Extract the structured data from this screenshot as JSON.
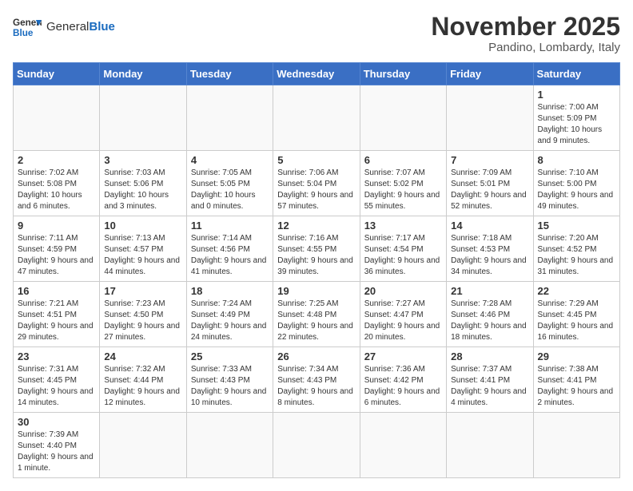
{
  "header": {
    "logo_general": "General",
    "logo_blue": "Blue",
    "month_title": "November 2025",
    "location": "Pandino, Lombardy, Italy"
  },
  "days_of_week": [
    "Sunday",
    "Monday",
    "Tuesday",
    "Wednesday",
    "Thursday",
    "Friday",
    "Saturday"
  ],
  "weeks": [
    [
      {
        "day": "",
        "info": ""
      },
      {
        "day": "",
        "info": ""
      },
      {
        "day": "",
        "info": ""
      },
      {
        "day": "",
        "info": ""
      },
      {
        "day": "",
        "info": ""
      },
      {
        "day": "",
        "info": ""
      },
      {
        "day": "1",
        "info": "Sunrise: 7:00 AM\nSunset: 5:09 PM\nDaylight: 10 hours and 9 minutes."
      }
    ],
    [
      {
        "day": "2",
        "info": "Sunrise: 7:02 AM\nSunset: 5:08 PM\nDaylight: 10 hours and 6 minutes."
      },
      {
        "day": "3",
        "info": "Sunrise: 7:03 AM\nSunset: 5:06 PM\nDaylight: 10 hours and 3 minutes."
      },
      {
        "day": "4",
        "info": "Sunrise: 7:05 AM\nSunset: 5:05 PM\nDaylight: 10 hours and 0 minutes."
      },
      {
        "day": "5",
        "info": "Sunrise: 7:06 AM\nSunset: 5:04 PM\nDaylight: 9 hours and 57 minutes."
      },
      {
        "day": "6",
        "info": "Sunrise: 7:07 AM\nSunset: 5:02 PM\nDaylight: 9 hours and 55 minutes."
      },
      {
        "day": "7",
        "info": "Sunrise: 7:09 AM\nSunset: 5:01 PM\nDaylight: 9 hours and 52 minutes."
      },
      {
        "day": "8",
        "info": "Sunrise: 7:10 AM\nSunset: 5:00 PM\nDaylight: 9 hours and 49 minutes."
      }
    ],
    [
      {
        "day": "9",
        "info": "Sunrise: 7:11 AM\nSunset: 4:59 PM\nDaylight: 9 hours and 47 minutes."
      },
      {
        "day": "10",
        "info": "Sunrise: 7:13 AM\nSunset: 4:57 PM\nDaylight: 9 hours and 44 minutes."
      },
      {
        "day": "11",
        "info": "Sunrise: 7:14 AM\nSunset: 4:56 PM\nDaylight: 9 hours and 41 minutes."
      },
      {
        "day": "12",
        "info": "Sunrise: 7:16 AM\nSunset: 4:55 PM\nDaylight: 9 hours and 39 minutes."
      },
      {
        "day": "13",
        "info": "Sunrise: 7:17 AM\nSunset: 4:54 PM\nDaylight: 9 hours and 36 minutes."
      },
      {
        "day": "14",
        "info": "Sunrise: 7:18 AM\nSunset: 4:53 PM\nDaylight: 9 hours and 34 minutes."
      },
      {
        "day": "15",
        "info": "Sunrise: 7:20 AM\nSunset: 4:52 PM\nDaylight: 9 hours and 31 minutes."
      }
    ],
    [
      {
        "day": "16",
        "info": "Sunrise: 7:21 AM\nSunset: 4:51 PM\nDaylight: 9 hours and 29 minutes."
      },
      {
        "day": "17",
        "info": "Sunrise: 7:23 AM\nSunset: 4:50 PM\nDaylight: 9 hours and 27 minutes."
      },
      {
        "day": "18",
        "info": "Sunrise: 7:24 AM\nSunset: 4:49 PM\nDaylight: 9 hours and 24 minutes."
      },
      {
        "day": "19",
        "info": "Sunrise: 7:25 AM\nSunset: 4:48 PM\nDaylight: 9 hours and 22 minutes."
      },
      {
        "day": "20",
        "info": "Sunrise: 7:27 AM\nSunset: 4:47 PM\nDaylight: 9 hours and 20 minutes."
      },
      {
        "day": "21",
        "info": "Sunrise: 7:28 AM\nSunset: 4:46 PM\nDaylight: 9 hours and 18 minutes."
      },
      {
        "day": "22",
        "info": "Sunrise: 7:29 AM\nSunset: 4:45 PM\nDaylight: 9 hours and 16 minutes."
      }
    ],
    [
      {
        "day": "23",
        "info": "Sunrise: 7:31 AM\nSunset: 4:45 PM\nDaylight: 9 hours and 14 minutes."
      },
      {
        "day": "24",
        "info": "Sunrise: 7:32 AM\nSunset: 4:44 PM\nDaylight: 9 hours and 12 minutes."
      },
      {
        "day": "25",
        "info": "Sunrise: 7:33 AM\nSunset: 4:43 PM\nDaylight: 9 hours and 10 minutes."
      },
      {
        "day": "26",
        "info": "Sunrise: 7:34 AM\nSunset: 4:43 PM\nDaylight: 9 hours and 8 minutes."
      },
      {
        "day": "27",
        "info": "Sunrise: 7:36 AM\nSunset: 4:42 PM\nDaylight: 9 hours and 6 minutes."
      },
      {
        "day": "28",
        "info": "Sunrise: 7:37 AM\nSunset: 4:41 PM\nDaylight: 9 hours and 4 minutes."
      },
      {
        "day": "29",
        "info": "Sunrise: 7:38 AM\nSunset: 4:41 PM\nDaylight: 9 hours and 2 minutes."
      }
    ],
    [
      {
        "day": "30",
        "info": "Sunrise: 7:39 AM\nSunset: 4:40 PM\nDaylight: 9 hours and 1 minute."
      },
      {
        "day": "",
        "info": ""
      },
      {
        "day": "",
        "info": ""
      },
      {
        "day": "",
        "info": ""
      },
      {
        "day": "",
        "info": ""
      },
      {
        "day": "",
        "info": ""
      },
      {
        "day": "",
        "info": ""
      }
    ]
  ]
}
